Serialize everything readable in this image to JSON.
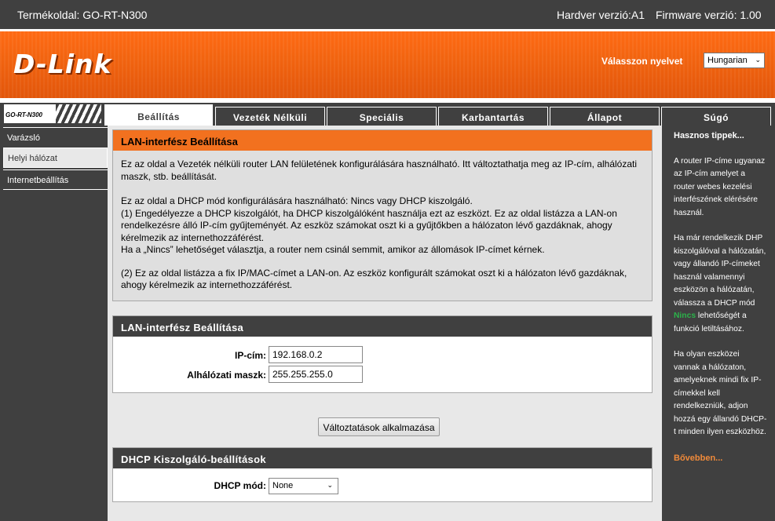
{
  "topbar": {
    "product": "Termékoldal: GO-RT-N300",
    "hardware": "Hardver verzió:A1",
    "firmware": "Firmware verzió: 1.00"
  },
  "header": {
    "logo": "D-Link",
    "language_label": "Válasszon nyelvet",
    "language_value": "Hungarian"
  },
  "model_tab": "GO-RT-N300",
  "tabs": [
    "Beállítás",
    "Vezeték Nélküli",
    "Speciális",
    "Karbantartás",
    "Állapot",
    "Súgó"
  ],
  "sidebar": {
    "items": [
      "Varázsló",
      "Helyi hálózat",
      "Internetbeállítás"
    ]
  },
  "intro": {
    "title": "LAN-interfész Beállítása",
    "p1": "Ez az oldal a Vezeték nélküli router LAN felületének konfigurálására használható. Itt változtathatja meg az IP-cím, alhálózati maszk, stb. beállítását.",
    "p2_lines": [
      "Ez az oldal a DHCP mód konfigurálására használható: Nincs vagy DHCP kiszolgáló.",
      "(1) Engedélyezze a DHCP kiszolgálót, ha DHCP kiszolgálóként használja ezt az eszközt. Ez az oldal listázza a LAN-on rendelkezésre álló IP-cím gyűjteményét. Az eszköz számokat oszt ki a gyűjtőkben a hálózaton lévő gazdáknak, ahogy kérelmezik az internethozzáférést.",
      "Ha a „Nincs” lehetőséget választja, a router nem csinál semmit, amikor az állomások IP-címet kérnek."
    ],
    "p3": "(2) Ez az oldal listázza a fix IP/MAC-címet a LAN-on. Az eszköz konfigurált számokat oszt ki a hálózaton lévő gazdáknak, ahogy kérelmezik az internethozzáférést."
  },
  "lan": {
    "title": "LAN-interfész Beállítása",
    "ip_label": "IP-cím:",
    "ip_value": "192.168.0.2",
    "mask_label": "Alhálózati maszk:",
    "mask_value": "255.255.255.0"
  },
  "apply_button": "Változtatások alkalmazása",
  "dhcp": {
    "title": "DHCP Kiszolgáló-beállítások",
    "mode_label": "DHCP mód:",
    "mode_value": "None"
  },
  "tips": {
    "title": "Hasznos tippek...",
    "t1": "A router IP-címe ugyanaz az IP-cím amelyet a router webes kezelési interfészének elérésére használ.",
    "t2_a": "Ha már rendelkezik DHP kiszolgálóval a hálózatán, vagy állandó IP-címeket használ valamennyi eszközön a hálózatán, válassza a DHCP mód",
    "t2_green": "Nincs",
    "t2_b": "lehetőségét a funkció letiltásához.",
    "t3": "Ha olyan eszközei vannak a hálózaton, amelyeknek mindi fix IP-címekkel kell rendelkezniük, adjon hozzá egy állandó DHCP-t minden ilyen eszközhöz.",
    "more": "Bővebben..."
  },
  "colors": {
    "accent": "#f2711f",
    "dark": "#404040",
    "tip_green": "#2bb34a"
  }
}
